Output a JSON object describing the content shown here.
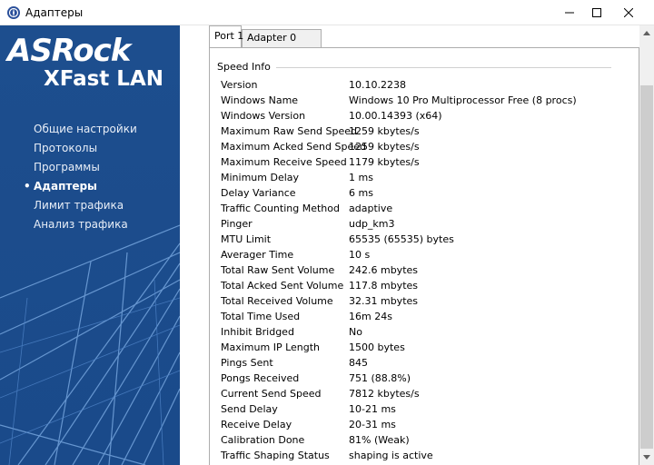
{
  "window": {
    "title": "Адаптеры"
  },
  "logo": {
    "line1": "ASRock",
    "line2": "XFast LAN"
  },
  "sidebar": {
    "items": [
      {
        "label": "Общие настройки",
        "active": false
      },
      {
        "label": "Протоколы",
        "active": false
      },
      {
        "label": "Программы",
        "active": false
      },
      {
        "label": "Адаптеры",
        "active": true
      },
      {
        "label": "Лимит трафика",
        "active": false
      },
      {
        "label": "Анализ трафика",
        "active": false
      }
    ],
    "bullet": "•"
  },
  "tabs": [
    {
      "label": "Port 1",
      "active": true
    },
    {
      "label": "Adapter 0",
      "active": false
    }
  ],
  "speed_info": {
    "title": "Speed Info",
    "rows": [
      {
        "key": "Version",
        "value": "10.10.2238"
      },
      {
        "key": "Windows Name",
        "value": "Windows 10 Pro Multiprocessor Free (8 procs)"
      },
      {
        "key": "Windows Version",
        "value": "10.00.14393 (x64)"
      },
      {
        "key": "Maximum Raw Send Speed",
        "value": "1259 kbytes/s"
      },
      {
        "key": "Maximum Acked Send Speed",
        "value": "1259 kbytes/s"
      },
      {
        "key": "Maximum Receive Speed",
        "value": "1179 kbytes/s"
      },
      {
        "key": "Minimum Delay",
        "value": "1 ms"
      },
      {
        "key": "Delay Variance",
        "value": "6 ms"
      },
      {
        "key": "Traffic Counting Method",
        "value": "adaptive"
      },
      {
        "key": "Pinger",
        "value": "udp_km3"
      },
      {
        "key": "MTU Limit",
        "value": "65535 (65535) bytes"
      },
      {
        "key": "Averager Time",
        "value": "10 s"
      },
      {
        "key": "Total Raw Sent Volume",
        "value": "242.6 mbytes"
      },
      {
        "key": "Total Acked Sent Volume",
        "value": "117.8 mbytes"
      },
      {
        "key": "Total Received Volume",
        "value": "32.31 mbytes"
      },
      {
        "key": "Total Time Used",
        "value": "16m 24s"
      },
      {
        "key": "Inhibit Bridged",
        "value": "No"
      },
      {
        "key": "Maximum IP Length",
        "value": "1500 bytes"
      },
      {
        "key": "Pings Sent",
        "value": "845"
      },
      {
        "key": "Pongs Received",
        "value": "751 (88.8%)"
      },
      {
        "key": "Current Send Speed",
        "value": "7812 kbytes/s"
      },
      {
        "key": "Send Delay",
        "value": "10-21 ms"
      },
      {
        "key": "Receive Delay",
        "value": "20-31 ms"
      },
      {
        "key": "Calibration Done",
        "value": "81% (Weak)"
      },
      {
        "key": "Traffic Shaping Status",
        "value": "shaping is active"
      }
    ]
  },
  "colors": {
    "sidebar_bg": "#1e4f8c",
    "sidebar_text": "#e8eef7"
  }
}
